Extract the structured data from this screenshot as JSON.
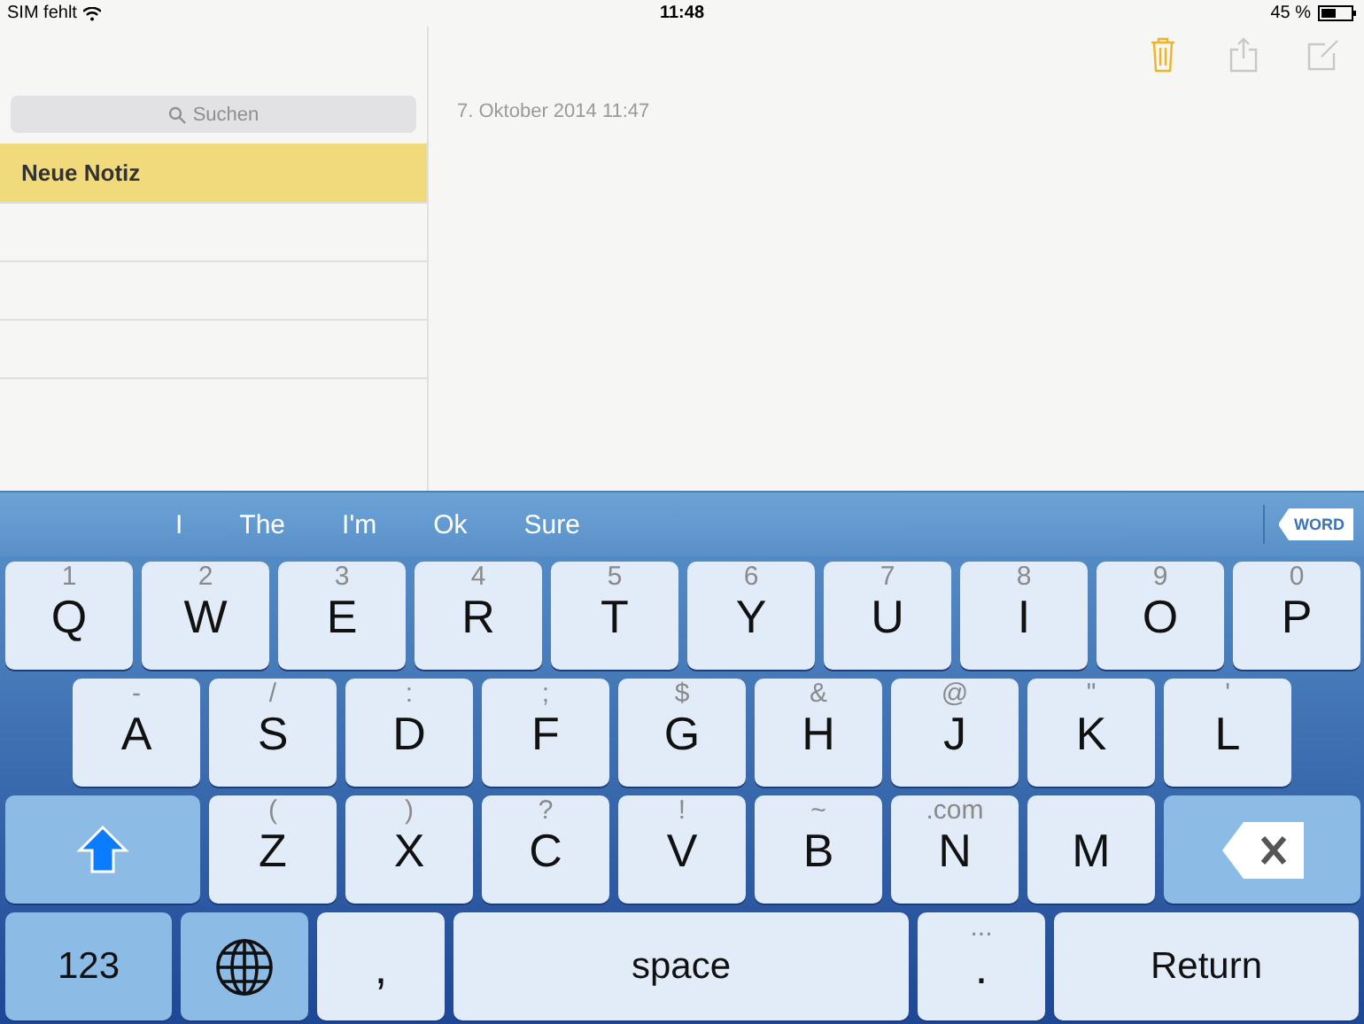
{
  "status_bar": {
    "carrier": "SIM fehlt",
    "time": "11:48",
    "battery": "45 %"
  },
  "sidebar": {
    "search": {
      "placeholder": "Suchen"
    },
    "notes": [
      {
        "title": "Neue Notiz",
        "selected": true
      }
    ]
  },
  "note": {
    "date": "7. Oktober 2014 11:47"
  },
  "keyboard": {
    "suggestions": [
      "I",
      "The",
      "I'm",
      "Ok",
      "Sure"
    ],
    "word_badge": "WORD",
    "rows": [
      {
        "keys": [
          {
            "kind": "letter",
            "label": "Q",
            "hint": "1"
          },
          {
            "kind": "letter",
            "label": "W",
            "hint": "2"
          },
          {
            "kind": "letter",
            "label": "E",
            "hint": "3"
          },
          {
            "kind": "letter",
            "label": "R",
            "hint": "4"
          },
          {
            "kind": "letter",
            "label": "T",
            "hint": "5"
          },
          {
            "kind": "letter",
            "label": "Y",
            "hint": "6"
          },
          {
            "kind": "letter",
            "label": "U",
            "hint": "7"
          },
          {
            "kind": "letter",
            "label": "I",
            "hint": "8"
          },
          {
            "kind": "letter",
            "label": "O",
            "hint": "9"
          },
          {
            "kind": "letter",
            "label": "P",
            "hint": "0"
          }
        ]
      },
      {
        "keys": [
          {
            "kind": "letter",
            "label": "A",
            "hint": "-"
          },
          {
            "kind": "letter",
            "label": "S",
            "hint": "/"
          },
          {
            "kind": "letter",
            "label": "D",
            "hint": ":"
          },
          {
            "kind": "letter",
            "label": "F",
            "hint": ";"
          },
          {
            "kind": "letter",
            "label": "G",
            "hint": "$"
          },
          {
            "kind": "letter",
            "label": "H",
            "hint": "&"
          },
          {
            "kind": "letter",
            "label": "J",
            "hint": "@"
          },
          {
            "kind": "letter",
            "label": "K",
            "hint": "\""
          },
          {
            "kind": "letter",
            "label": "L",
            "hint": "'"
          }
        ]
      },
      {
        "keys": [
          {
            "kind": "shift",
            "on": true
          },
          {
            "kind": "letter",
            "label": "Z",
            "hint": "("
          },
          {
            "kind": "letter",
            "label": "X",
            "hint": ")"
          },
          {
            "kind": "letter",
            "label": "C",
            "hint": "?"
          },
          {
            "kind": "letter",
            "label": "V",
            "hint": "!"
          },
          {
            "kind": "letter",
            "label": "B",
            "hint": "~"
          },
          {
            "kind": "letter",
            "label": "N",
            "hint": ".com"
          },
          {
            "kind": "letter",
            "label": "M"
          },
          {
            "kind": "backspace"
          }
        ]
      },
      {
        "keys": [
          {
            "kind": "mode",
            "label": "123"
          },
          {
            "kind": "globe"
          },
          {
            "kind": "punct",
            "label": ","
          },
          {
            "kind": "space",
            "label": "space"
          },
          {
            "kind": "punct",
            "label": ".",
            "hint": "..."
          },
          {
            "kind": "return",
            "label": "Return"
          }
        ]
      }
    ]
  }
}
